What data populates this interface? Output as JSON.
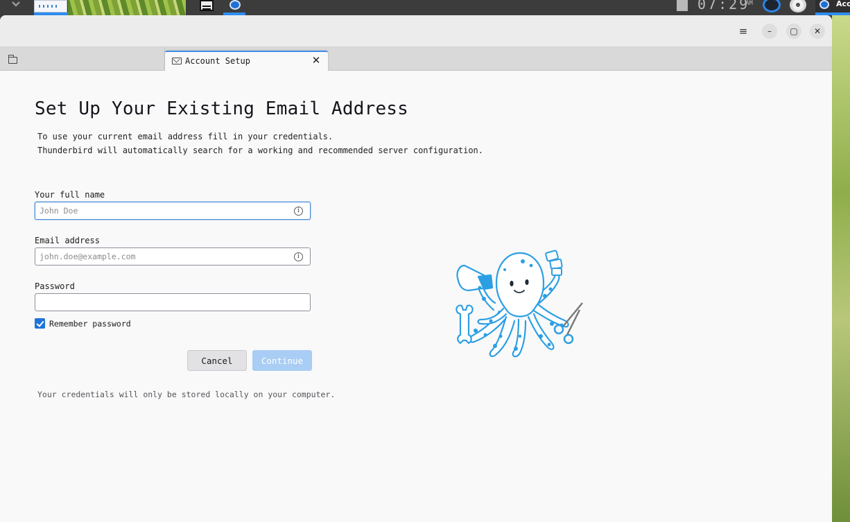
{
  "taskbar": {
    "clock": "07:29",
    "ampm": "AM",
    "active_window_label": "Acc"
  },
  "window": {
    "tabs": [
      {
        "label": "",
        "icon": "folder-icon"
      },
      {
        "label": "Account Setup",
        "icon": "envelope-icon",
        "close": "✕"
      }
    ],
    "controls": {
      "menu": "≡",
      "minimize": "–",
      "maximize": "▢",
      "close": "✕"
    }
  },
  "account_setup": {
    "heading": "Set Up Your Existing Email Address",
    "description_line1": "To use your current email address fill in your credentials.",
    "description_line2": "Thunderbird will automatically search for a working and recommended server configuration.",
    "full_name": {
      "label": "Your full name",
      "value": "",
      "placeholder": "John Doe"
    },
    "email": {
      "label": "Email address",
      "value": "",
      "placeholder": "john.doe@example.com"
    },
    "password": {
      "label": "Password",
      "value": ""
    },
    "remember_password": {
      "label": "Remember password",
      "checked": true
    },
    "cancel_label": "Cancel",
    "continue_label": "Continue",
    "privacy_note": "Your credentials will only be stored locally on your computer."
  },
  "colors": {
    "accent": "#1f74d8",
    "continue_disabled": "#a9cdf4",
    "illustration": "#2c9fe3"
  }
}
